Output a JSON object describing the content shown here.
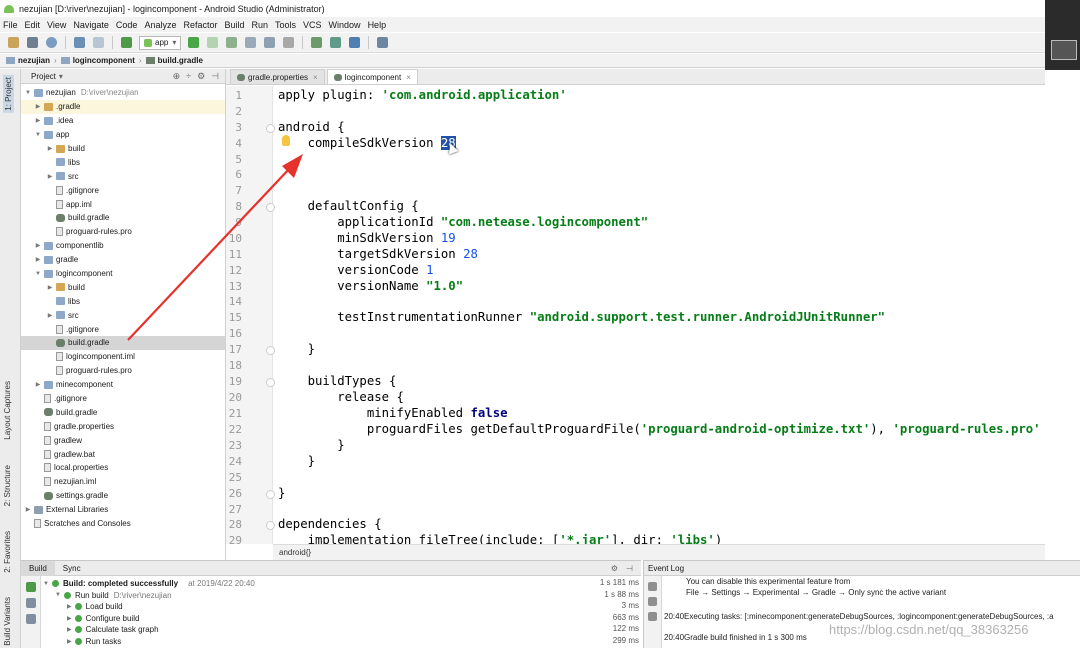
{
  "window": {
    "title": "nezujian [D:\\river\\nezujian] - logincomponent - Android Studio (Administrator)"
  },
  "menu": [
    "File",
    "Edit",
    "View",
    "Navigate",
    "Code",
    "Analyze",
    "Refactor",
    "Build",
    "Run",
    "Tools",
    "VCS",
    "Window",
    "Help"
  ],
  "toolbar": {
    "run_config": "app"
  },
  "nav": {
    "crumbs": [
      "nezujian",
      "logincomponent",
      "build.gradle"
    ]
  },
  "left_strip": {
    "tabs": [
      "1: Project",
      "Layout Captures",
      "2: Structure",
      "2: Favorites",
      "Build Variants"
    ]
  },
  "project_panel": {
    "header": "Project",
    "tree": [
      {
        "label": "nezujian",
        "hint": "D:\\river\\nezujian"
      },
      {
        "label": ".gradle"
      },
      {
        "label": ".idea"
      },
      {
        "label": "app"
      },
      {
        "label": "build"
      },
      {
        "label": "libs"
      },
      {
        "label": "src"
      },
      {
        "label": ".gitignore"
      },
      {
        "label": "app.iml"
      },
      {
        "label": "build.gradle"
      },
      {
        "label": "proguard-rules.pro"
      },
      {
        "label": "componentlib"
      },
      {
        "label": "gradle"
      },
      {
        "label": "logincomponent"
      },
      {
        "label": "build"
      },
      {
        "label": "libs"
      },
      {
        "label": "src"
      },
      {
        "label": ".gitignore"
      },
      {
        "label": "build.gradle"
      },
      {
        "label": "logincomponent.iml"
      },
      {
        "label": "proguard-rules.pro"
      },
      {
        "label": "minecomponent"
      },
      {
        "label": ".gitignore"
      },
      {
        "label": "build.gradle"
      },
      {
        "label": "gradle.properties"
      },
      {
        "label": "gradlew"
      },
      {
        "label": "gradlew.bat"
      },
      {
        "label": "local.properties"
      },
      {
        "label": "nezujian.iml"
      },
      {
        "label": "settings.gradle"
      },
      {
        "label": "External Libraries"
      },
      {
        "label": "Scratches and Consoles"
      }
    ]
  },
  "editor": {
    "tabs": [
      "gradle.properties",
      "logincomponent"
    ],
    "line_numbers": [
      "1",
      "2",
      "3",
      "4",
      "5",
      "6",
      "7",
      "8",
      "9",
      "10",
      "11",
      "12",
      "13",
      "14",
      "15",
      "16",
      "17",
      "18",
      "19",
      "20",
      "21",
      "22",
      "23",
      "24",
      "25",
      "26",
      "27",
      "28",
      "29"
    ],
    "code": {
      "l1a": "apply plugin: ",
      "l1b": "'com.android.application'",
      "l3": "android {",
      "l4a": "    compileSdkVersion ",
      "l4b": "28",
      "l8": "    defaultConfig {",
      "l9a": "        applicationId ",
      "l9b": "\"com.netease.logincomponent\"",
      "l10a": "        minSdkVersion ",
      "l10b": "19",
      "l11a": "        targetSdkVersion ",
      "l11b": "28",
      "l12a": "        versionCode ",
      "l12b": "1",
      "l13a": "        versionName ",
      "l13b": "\"1.0\"",
      "l15a": "        testInstrumentationRunner ",
      "l15b": "\"android.support.test.runner.AndroidJUnitRunner\"",
      "l17": "    }",
      "l19": "    buildTypes {",
      "l20": "        release {",
      "l21a": "            minifyEnabled ",
      "l21b": "false",
      "l22a": "            proguardFiles getDefaultProguardFile(",
      "l22b": "'proguard-android-optimize.txt'",
      "l22c": "), ",
      "l22d": "'proguard-rules.pro'",
      "l23": "        }",
      "l24": "    }",
      "l26": "}",
      "l28": "dependencies {",
      "l29a": "    implementation fileTree(include: [",
      "l29b": "'*.jar'",
      "l29c": "], dir: ",
      "l29d": "'libs'",
      "l29e": ")"
    },
    "breadcrumb": "android{}"
  },
  "build_panel": {
    "tabs": [
      "Build",
      "Sync"
    ],
    "rows": [
      {
        "label": "Build: completed successfully",
        "detail": "at 2019/4/22 20:40",
        "time": "1 s 181 ms"
      },
      {
        "label": "Run build",
        "detail": "D:\\river\\nezujian",
        "time": "1 s 88 ms"
      },
      {
        "label": "Load build",
        "time": "3 ms"
      },
      {
        "label": "Configure build",
        "time": "663 ms"
      },
      {
        "label": "Calculate task graph",
        "time": "122 ms"
      },
      {
        "label": "Run tasks",
        "time": "299 ms"
      }
    ]
  },
  "event_log": {
    "title": "Event Log",
    "lines": [
      "You can disable this experimental feature from",
      "File → Settings → Experimental → Gradle → Only sync the active variant",
      "20:40Executing tasks: [:minecomponent:generateDebugSources, :logincomponent:generateDebugSources, :a",
      "20:40Gradle build finished in 1 s 300 ms"
    ]
  },
  "watermark": "https://blog.csdn.net/qq_38363256"
}
